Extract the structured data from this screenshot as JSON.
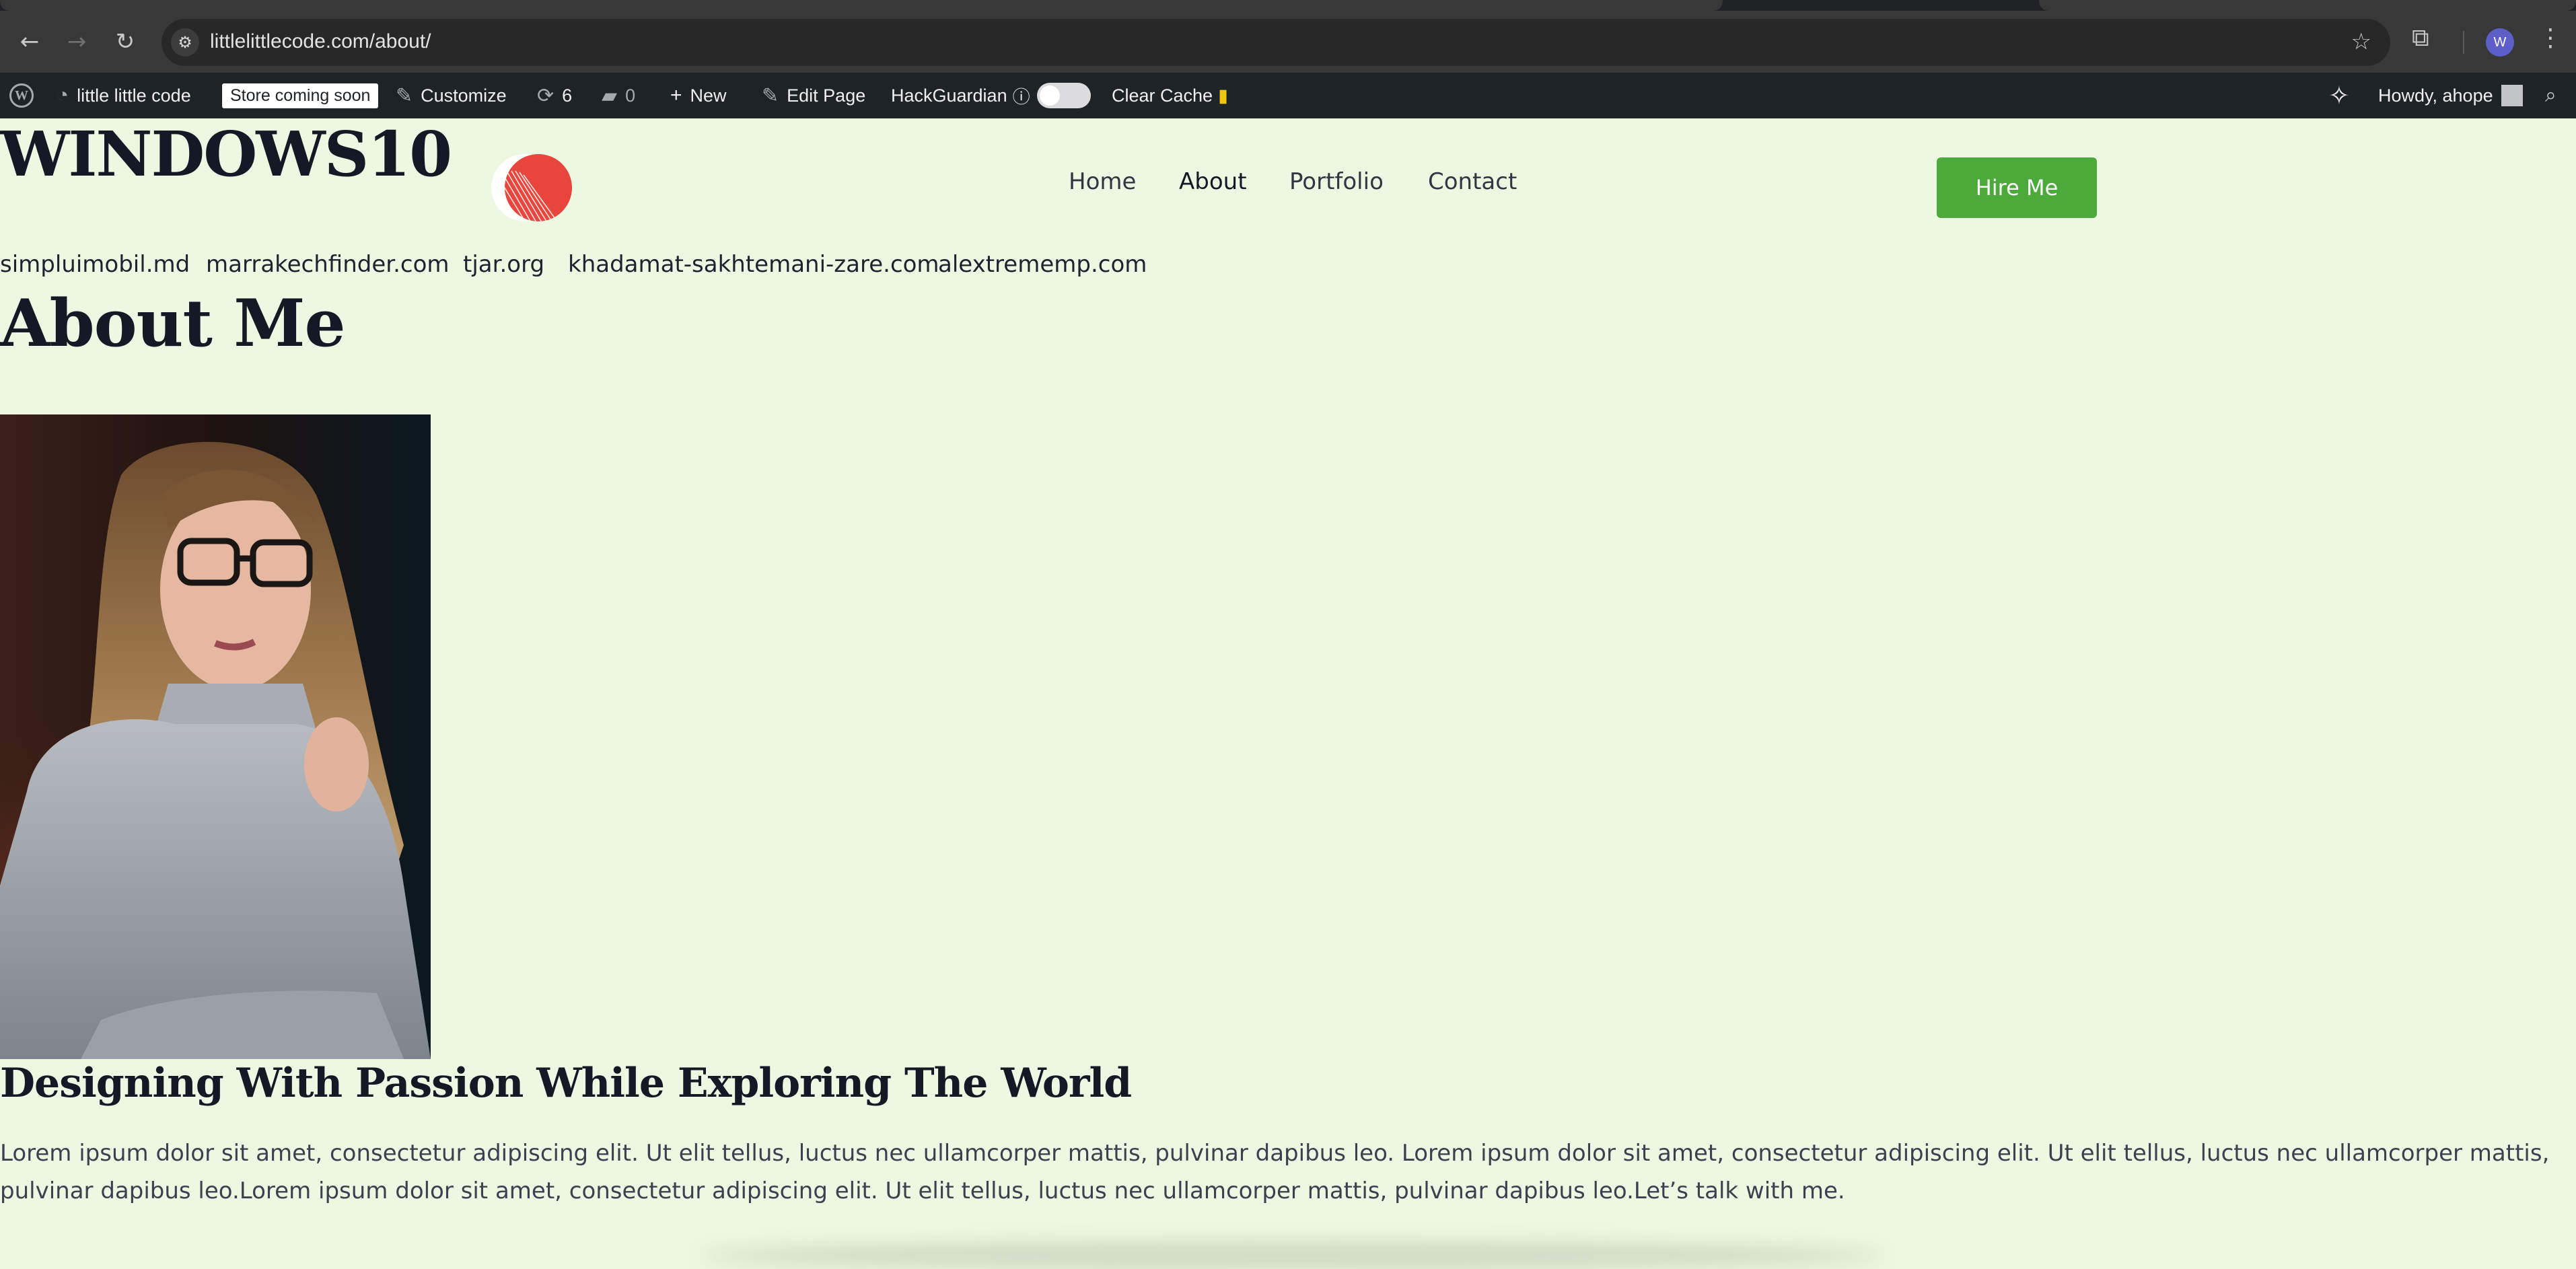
{
  "browser": {
    "url": "littlelittlecode.com/about/",
    "profile_initial": "W",
    "icons": {
      "back": "back-arrow-icon",
      "forward": "forward-arrow-icon",
      "reload": "reload-icon",
      "site_info": "tune-icon",
      "bookmark": "star-icon",
      "extensions": "puzzle-icon",
      "menu": "kebab-menu-icon"
    }
  },
  "admin_bar": {
    "site_name": "little little code",
    "store_badge": "Store coming soon",
    "customize": "Customize",
    "updates_count": "6",
    "comments_count": "0",
    "new_label": "New",
    "edit_page": "Edit Page",
    "hackguardian": "HackGuardian",
    "clear_cache": "Clear Cache",
    "howdy": "Howdy, ahope"
  },
  "header": {
    "site_title": "WINDOWS10",
    "nav": [
      "Home",
      "About",
      "Portfolio",
      "Contact"
    ],
    "active_nav": "About",
    "cta": "Hire Me"
  },
  "links": [
    "simpluimobil.md",
    "marrakechfinder.com",
    "tjar.org",
    "khadamat-sakhtemani-zare.com",
    "alextrememp.com"
  ],
  "page": {
    "title": "About Me",
    "section_heading": "Designing With Passion While Exploring The World",
    "body": "Lorem ipsum dolor sit amet, consectetur adipiscing elit. Ut elit tellus, luctus nec ullamcorper mattis, pulvinar dapibus leo. Lorem ipsum dolor sit amet, consectetur adipiscing elit. Ut elit tellus, luctus nec ullamcorper mattis, pulvinar dapibus leo.Lorem ipsum dolor sit amet, consectetur adipiscing elit. Ut elit tellus, luctus nec ullamcorper mattis, pulvinar dapibus leo.Let’s talk with me."
  },
  "colors": {
    "page_bg": "#edf8e2",
    "cta_bg": "#4caa3a",
    "admin_bar_bg": "#1d2327",
    "logo_red": "#e8453c"
  }
}
